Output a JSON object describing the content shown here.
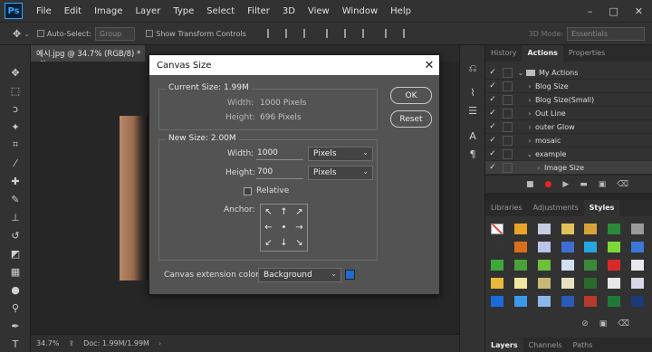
{
  "app": {
    "logo": "Ps"
  },
  "menubar": {
    "items": [
      "File",
      "Edit",
      "Image",
      "Layer",
      "Type",
      "Select",
      "Filter",
      "3D",
      "View",
      "Window",
      "Help"
    ],
    "controls": [
      "–",
      "□",
      "✕"
    ]
  },
  "options_bar": {
    "auto_select_label": "Auto-Select:",
    "group_value": "Group",
    "show_transform_label": "Show Transform Controls",
    "mode_label": "3D Mode:",
    "workspace_value": "Essentials"
  },
  "document": {
    "tab_label": "예시.jpg @ 34.7% (RGB/8) *",
    "tab_close": "×"
  },
  "statusbar": {
    "zoom": "34.7%",
    "doc_info": "Doc: 1.99M/1.99M"
  },
  "dialog": {
    "title": "Canvas Size",
    "current": {
      "heading": "Current Size: 1.99M",
      "width_label": "Width:",
      "width_value": "1000 Pixels",
      "height_label": "Height:",
      "height_value": "696 Pixels"
    },
    "new": {
      "heading": "New Size: 2.00M",
      "width_label": "Width:",
      "width_value": "1000",
      "width_unit": "Pixels",
      "height_label": "Height:",
      "height_value": "700",
      "height_unit": "Pixels",
      "relative_label": "Relative",
      "anchor_label": "Anchor:"
    },
    "extension_label": "Canvas extension color:",
    "extension_value": "Background",
    "extension_swatch": "#1f6bd1",
    "ok_label": "OK",
    "reset_label": "Reset"
  },
  "panels": {
    "top_tabs": [
      "History",
      "Actions",
      "Properties"
    ],
    "actions": [
      {
        "label": "My Actions",
        "type": "folder",
        "expanded": true
      },
      {
        "label": "Blog Size",
        "type": "action"
      },
      {
        "label": "Blog Size(Small)",
        "type": "action"
      },
      {
        "label": "Out Line",
        "type": "action"
      },
      {
        "label": "outer Glow",
        "type": "action"
      },
      {
        "label": "mosaic",
        "type": "action"
      },
      {
        "label": "example",
        "type": "action",
        "expanded": true
      },
      {
        "label": "Image Size",
        "type": "step"
      }
    ],
    "mid_tabs": [
      "Libraries",
      "Adjustments",
      "Styles"
    ],
    "bottom_tabs": [
      "Layers",
      "Channels",
      "Paths"
    ]
  }
}
